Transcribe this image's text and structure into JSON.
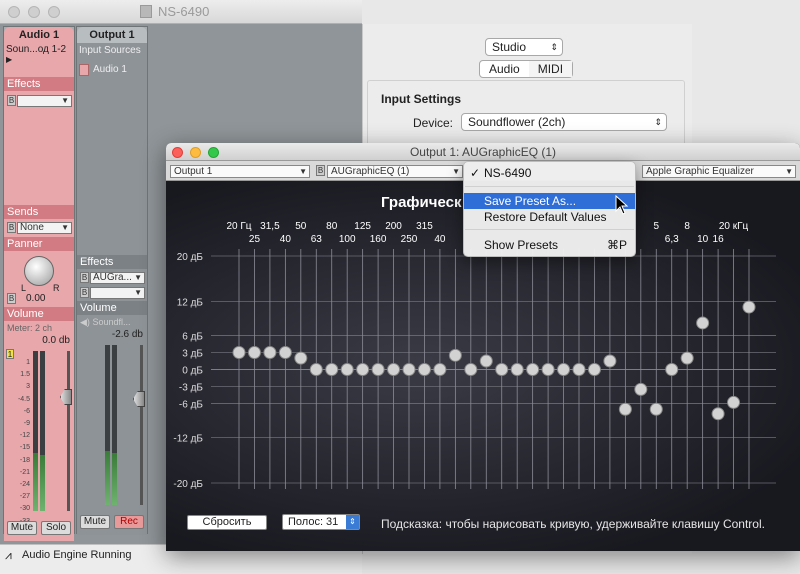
{
  "mixer_window": {
    "title": "NS-6490",
    "channel1": {
      "name": "Audio 1",
      "input": "Soun...од 1-2",
      "effects_label": "Effects",
      "sends_label": "Sends",
      "sends_value": "None",
      "panner_label": "Panner",
      "pan_left": "L",
      "pan_right": "R",
      "pan_value": "0.00",
      "volume_label": "Volume",
      "meter_label": "Meter: 2 ch",
      "volume_db": "0.0 db",
      "mute_label": "Mute",
      "solo_label": "Solo",
      "track_number": "1"
    },
    "channel2": {
      "name": "Output 1",
      "input_label": "Input Sources",
      "input_item": "Audio 1",
      "effects_label": "Effects",
      "effect1": "AUGra...",
      "volume_label": "Volume",
      "source_label": "Soundfl...",
      "volume_db": "-2.6 db",
      "mute_label": "Mute",
      "rec_label": "Rec"
    },
    "meter_scale": [
      "1",
      "1.5",
      "3",
      "-4.5",
      "-6",
      "-9",
      "-12",
      "-15",
      "-18",
      "-21",
      "-24",
      "-27",
      "-30",
      "-33"
    ],
    "status": "Audio Engine Running"
  },
  "settings_panel": {
    "device_select": "Studio",
    "tabs": [
      "Audio",
      "MIDI"
    ],
    "active_tab": "MIDI",
    "section_title": "Input Settings",
    "device_label": "Device:",
    "device_value": "Soundflower (2ch)"
  },
  "eq_window": {
    "title": "Output 1: AUGraphicEQ (1)",
    "toolbar": {
      "output_select": "Output 1",
      "plugin_select": "AUGraphicEQ (1)",
      "type_select": "Apple Graphic Equalizer",
      "b_label": "B"
    },
    "heading": "Графическ",
    "freq_labels_top": [
      "20 Гц",
      "31,5",
      "50",
      "80",
      "125",
      "200",
      "315",
      "5",
      "8",
      "20 кГц"
    ],
    "freq_labels_bottom": [
      "25",
      "40",
      "63",
      "100",
      "160",
      "250",
      "40",
      "6,3",
      "10",
      "16"
    ],
    "db_labels": [
      "20 дБ",
      "12 дБ",
      "6 дБ",
      "3 дБ",
      "0 дБ",
      "-3 дБ",
      "-6 дБ",
      "-12 дБ",
      "-20 дБ"
    ],
    "band_gains_db": [
      3,
      3,
      3,
      3,
      2,
      0,
      0,
      0,
      0,
      0,
      0,
      0,
      0,
      0,
      2.5,
      0,
      1.5,
      0,
      0,
      0,
      0,
      0,
      0,
      0,
      1.5,
      -7,
      -3.5,
      -7,
      0,
      2,
      8.2,
      -7.8,
      -5.8,
      11
    ],
    "reset_button": "Сбросить",
    "bands_label": "Полос: 31",
    "hint": "Подсказка: чтобы нарисовать кривую, удерживайте клавишу Control."
  },
  "context_menu": {
    "checked_item": "NS-6490",
    "items": [
      "Save Preset As...",
      "Restore Default Values",
      "Show Presets"
    ],
    "highlighted": "Save Preset As...",
    "show_presets_shortcut": "⌘P"
  }
}
